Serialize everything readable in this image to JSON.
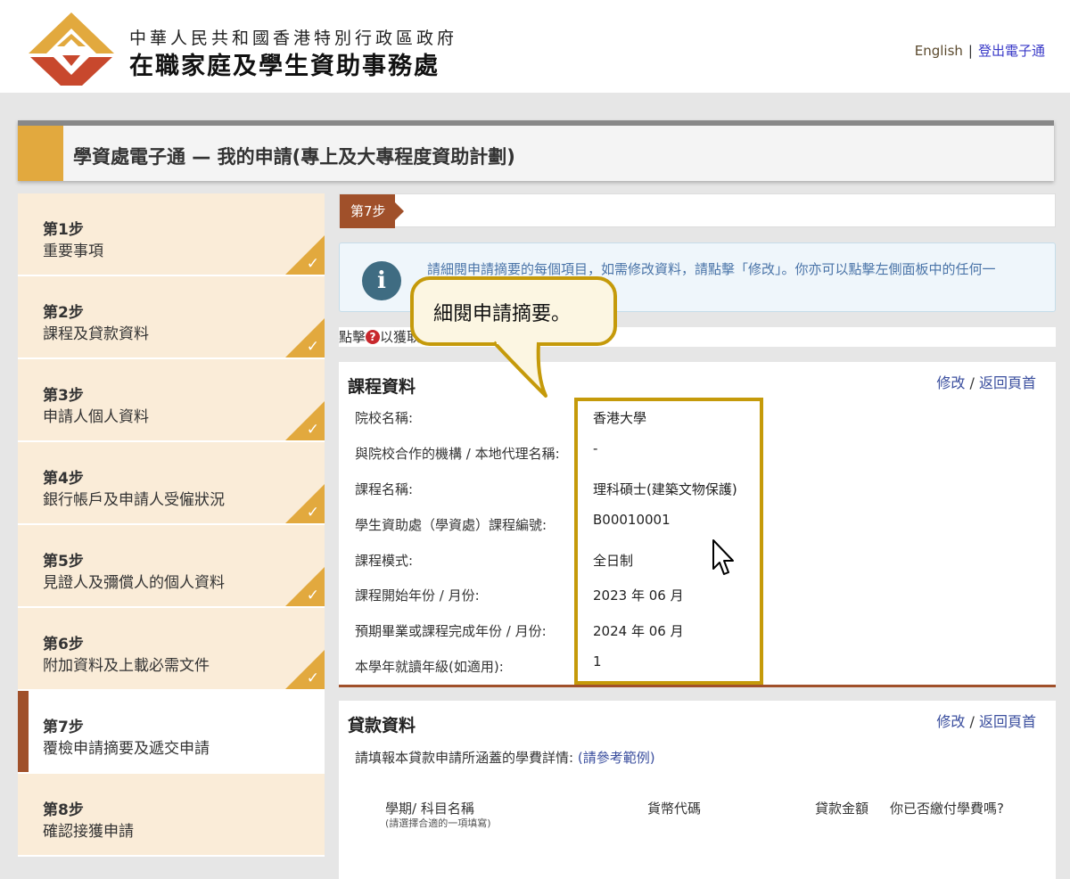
{
  "header": {
    "dept_line1": "中華人民共和國香港特別行政區政府",
    "dept_line2": "在職家庭及學生資助事務處",
    "lang_link": "English",
    "separator": "|",
    "logout_link": "登出電子通",
    "colors": {
      "logo_orange": "#e2a93e",
      "logo_red": "#c8482d"
    }
  },
  "page_title": "學資處電子通 — 我的申請(專上及大專程度資助計劃)",
  "sidebar": {
    "steps": [
      {
        "num": "第1步",
        "label": "重要事項",
        "done": true
      },
      {
        "num": "第2步",
        "label": "課程及貸款資料",
        "done": true
      },
      {
        "num": "第3步",
        "label": "申請人個人資料",
        "done": true
      },
      {
        "num": "第4步",
        "label": "銀行帳戶及申請人受僱狀況",
        "done": true
      },
      {
        "num": "第5步",
        "label": "見證人及彌償人的個人資料",
        "done": true
      },
      {
        "num": "第6步",
        "label": "附加資料及上載必需文件",
        "done": true
      },
      {
        "num": "第7步",
        "label": "覆檢申請摘要及遞交申請",
        "done": false,
        "active": true
      },
      {
        "num": "第8步",
        "label": "確認接獲申請",
        "done": false
      }
    ],
    "check_mark": "✓"
  },
  "main": {
    "step_tag": "第7步",
    "info_text": "請細閱申請摘要的每個項目，如需修改資料，請點擊「修改」。你亦可以點擊左側面板中的任何一",
    "help_prefix": "點擊",
    "help_icon": "?",
    "help_suffix": "以獲取",
    "course": {
      "title": "課程資料",
      "edit": "修改",
      "slash": " / ",
      "back": "返回頁首",
      "fields": [
        {
          "label": "院校名稱:",
          "value": "香港大學"
        },
        {
          "label": "與院校合作的機構 / 本地代理名稱:",
          "value": "-"
        },
        {
          "label": "課程名稱:",
          "value": "理科碩士(建築文物保護)"
        },
        {
          "label": "學生資助處（學資處）課程編號:",
          "value": "B00010001"
        },
        {
          "label": "課程模式:",
          "value": "全日制"
        },
        {
          "label": "課程開始年份 / 月份:",
          "value": "2023 年 06 月"
        },
        {
          "label": "預期畢業或課程完成年份 / 月份:",
          "value": "2024 年 06 月"
        },
        {
          "label": "本學年就讀年級(如適用):",
          "value": "1"
        }
      ]
    },
    "loan": {
      "title": "貸款資料",
      "edit": "修改",
      "slash": " / ",
      "back": "返回頁首",
      "intro": "請填報本貸款申請所涵蓋的學費詳情:",
      "intro_link": "(請參考範例)",
      "columns": [
        "學期/ 科目名稱",
        "貨幣代碼",
        "貸款金額",
        "你已否繳付學費嗎?"
      ],
      "column_sub": "(請選擇合適的一項填寫)"
    }
  },
  "callout": {
    "text": "細閱申請摘要。"
  }
}
